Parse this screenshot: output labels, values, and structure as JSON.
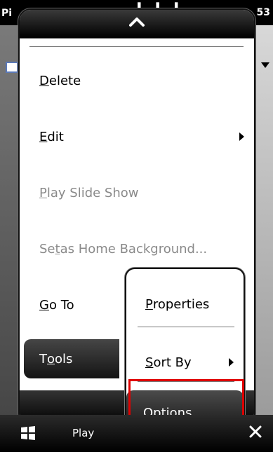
{
  "status_bar": {
    "left_fragment": "Pi",
    "right_fragment": "53"
  },
  "menu": {
    "items": [
      {
        "prefix": "",
        "mnemonic": "D",
        "suffix": "elete",
        "enabled": true,
        "submenu": false
      },
      {
        "prefix": "",
        "mnemonic": "E",
        "suffix": "dit",
        "enabled": true,
        "submenu": true
      },
      {
        "prefix": "",
        "mnemonic": "P",
        "suffix": "lay Slide Show",
        "enabled": false,
        "submenu": false
      },
      {
        "prefix": "Se",
        "mnemonic": "t",
        "suffix": " as Home Background...",
        "enabled": false,
        "submenu": false
      },
      {
        "prefix": "",
        "mnemonic": "G",
        "suffix": "o To",
        "enabled": true,
        "submenu": false
      },
      {
        "prefix": "T",
        "mnemonic": "o",
        "suffix": "ols",
        "enabled": true,
        "submenu": true,
        "selected": true
      }
    ]
  },
  "submenu": {
    "items": [
      {
        "prefix": "",
        "mnemonic": "P",
        "suffix": "roperties"
      },
      {
        "prefix": "",
        "mnemonic": "S",
        "suffix": "ort By",
        "submenu": true
      },
      {
        "prefix": "",
        "mnemonic": "O",
        "suffix": "ptions...",
        "selected": true
      }
    ]
  },
  "bottom_bar": {
    "left_softkey": "Play"
  },
  "colors": {
    "highlight_border": "#e00000",
    "disabled_text": "#8a8a8a"
  },
  "icons": {
    "up": "chevron-up-icon",
    "start": "windows-start-icon",
    "close": "close-icon",
    "submenu": "chevron-right-icon"
  }
}
